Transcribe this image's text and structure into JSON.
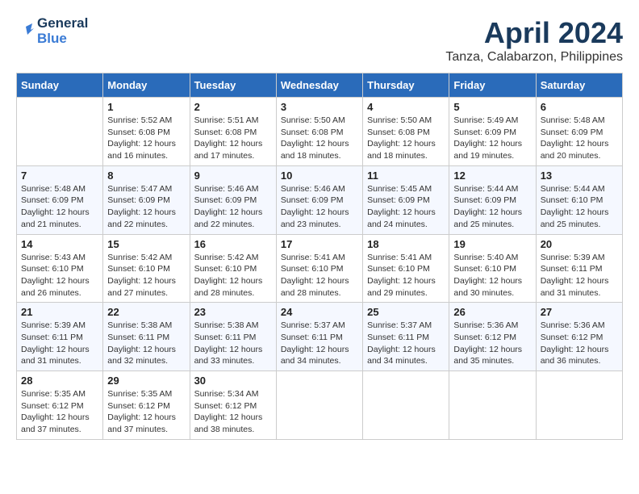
{
  "header": {
    "logo_general": "General",
    "logo_blue": "Blue",
    "month": "April 2024",
    "location": "Tanza, Calabarzon, Philippines"
  },
  "days_of_week": [
    "Sunday",
    "Monday",
    "Tuesday",
    "Wednesday",
    "Thursday",
    "Friday",
    "Saturday"
  ],
  "weeks": [
    [
      {
        "day": "",
        "sunrise": "",
        "sunset": "",
        "daylight": ""
      },
      {
        "day": "1",
        "sunrise": "Sunrise: 5:52 AM",
        "sunset": "Sunset: 6:08 PM",
        "daylight": "Daylight: 12 hours and 16 minutes."
      },
      {
        "day": "2",
        "sunrise": "Sunrise: 5:51 AM",
        "sunset": "Sunset: 6:08 PM",
        "daylight": "Daylight: 12 hours and 17 minutes."
      },
      {
        "day": "3",
        "sunrise": "Sunrise: 5:50 AM",
        "sunset": "Sunset: 6:08 PM",
        "daylight": "Daylight: 12 hours and 18 minutes."
      },
      {
        "day": "4",
        "sunrise": "Sunrise: 5:50 AM",
        "sunset": "Sunset: 6:08 PM",
        "daylight": "Daylight: 12 hours and 18 minutes."
      },
      {
        "day": "5",
        "sunrise": "Sunrise: 5:49 AM",
        "sunset": "Sunset: 6:09 PM",
        "daylight": "Daylight: 12 hours and 19 minutes."
      },
      {
        "day": "6",
        "sunrise": "Sunrise: 5:48 AM",
        "sunset": "Sunset: 6:09 PM",
        "daylight": "Daylight: 12 hours and 20 minutes."
      }
    ],
    [
      {
        "day": "7",
        "sunrise": "Sunrise: 5:48 AM",
        "sunset": "Sunset: 6:09 PM",
        "daylight": "Daylight: 12 hours and 21 minutes."
      },
      {
        "day": "8",
        "sunrise": "Sunrise: 5:47 AM",
        "sunset": "Sunset: 6:09 PM",
        "daylight": "Daylight: 12 hours and 22 minutes."
      },
      {
        "day": "9",
        "sunrise": "Sunrise: 5:46 AM",
        "sunset": "Sunset: 6:09 PM",
        "daylight": "Daylight: 12 hours and 22 minutes."
      },
      {
        "day": "10",
        "sunrise": "Sunrise: 5:46 AM",
        "sunset": "Sunset: 6:09 PM",
        "daylight": "Daylight: 12 hours and 23 minutes."
      },
      {
        "day": "11",
        "sunrise": "Sunrise: 5:45 AM",
        "sunset": "Sunset: 6:09 PM",
        "daylight": "Daylight: 12 hours and 24 minutes."
      },
      {
        "day": "12",
        "sunrise": "Sunrise: 5:44 AM",
        "sunset": "Sunset: 6:09 PM",
        "daylight": "Daylight: 12 hours and 25 minutes."
      },
      {
        "day": "13",
        "sunrise": "Sunrise: 5:44 AM",
        "sunset": "Sunset: 6:10 PM",
        "daylight": "Daylight: 12 hours and 25 minutes."
      }
    ],
    [
      {
        "day": "14",
        "sunrise": "Sunrise: 5:43 AM",
        "sunset": "Sunset: 6:10 PM",
        "daylight": "Daylight: 12 hours and 26 minutes."
      },
      {
        "day": "15",
        "sunrise": "Sunrise: 5:42 AM",
        "sunset": "Sunset: 6:10 PM",
        "daylight": "Daylight: 12 hours and 27 minutes."
      },
      {
        "day": "16",
        "sunrise": "Sunrise: 5:42 AM",
        "sunset": "Sunset: 6:10 PM",
        "daylight": "Daylight: 12 hours and 28 minutes."
      },
      {
        "day": "17",
        "sunrise": "Sunrise: 5:41 AM",
        "sunset": "Sunset: 6:10 PM",
        "daylight": "Daylight: 12 hours and 28 minutes."
      },
      {
        "day": "18",
        "sunrise": "Sunrise: 5:41 AM",
        "sunset": "Sunset: 6:10 PM",
        "daylight": "Daylight: 12 hours and 29 minutes."
      },
      {
        "day": "19",
        "sunrise": "Sunrise: 5:40 AM",
        "sunset": "Sunset: 6:10 PM",
        "daylight": "Daylight: 12 hours and 30 minutes."
      },
      {
        "day": "20",
        "sunrise": "Sunrise: 5:39 AM",
        "sunset": "Sunset: 6:11 PM",
        "daylight": "Daylight: 12 hours and 31 minutes."
      }
    ],
    [
      {
        "day": "21",
        "sunrise": "Sunrise: 5:39 AM",
        "sunset": "Sunset: 6:11 PM",
        "daylight": "Daylight: 12 hours and 31 minutes."
      },
      {
        "day": "22",
        "sunrise": "Sunrise: 5:38 AM",
        "sunset": "Sunset: 6:11 PM",
        "daylight": "Daylight: 12 hours and 32 minutes."
      },
      {
        "day": "23",
        "sunrise": "Sunrise: 5:38 AM",
        "sunset": "Sunset: 6:11 PM",
        "daylight": "Daylight: 12 hours and 33 minutes."
      },
      {
        "day": "24",
        "sunrise": "Sunrise: 5:37 AM",
        "sunset": "Sunset: 6:11 PM",
        "daylight": "Daylight: 12 hours and 34 minutes."
      },
      {
        "day": "25",
        "sunrise": "Sunrise: 5:37 AM",
        "sunset": "Sunset: 6:11 PM",
        "daylight": "Daylight: 12 hours and 34 minutes."
      },
      {
        "day": "26",
        "sunrise": "Sunrise: 5:36 AM",
        "sunset": "Sunset: 6:12 PM",
        "daylight": "Daylight: 12 hours and 35 minutes."
      },
      {
        "day": "27",
        "sunrise": "Sunrise: 5:36 AM",
        "sunset": "Sunset: 6:12 PM",
        "daylight": "Daylight: 12 hours and 36 minutes."
      }
    ],
    [
      {
        "day": "28",
        "sunrise": "Sunrise: 5:35 AM",
        "sunset": "Sunset: 6:12 PM",
        "daylight": "Daylight: 12 hours and 37 minutes."
      },
      {
        "day": "29",
        "sunrise": "Sunrise: 5:35 AM",
        "sunset": "Sunset: 6:12 PM",
        "daylight": "Daylight: 12 hours and 37 minutes."
      },
      {
        "day": "30",
        "sunrise": "Sunrise: 5:34 AM",
        "sunset": "Sunset: 6:12 PM",
        "daylight": "Daylight: 12 hours and 38 minutes."
      },
      {
        "day": "",
        "sunrise": "",
        "sunset": "",
        "daylight": ""
      },
      {
        "day": "",
        "sunrise": "",
        "sunset": "",
        "daylight": ""
      },
      {
        "day": "",
        "sunrise": "",
        "sunset": "",
        "daylight": ""
      },
      {
        "day": "",
        "sunrise": "",
        "sunset": "",
        "daylight": ""
      }
    ]
  ]
}
